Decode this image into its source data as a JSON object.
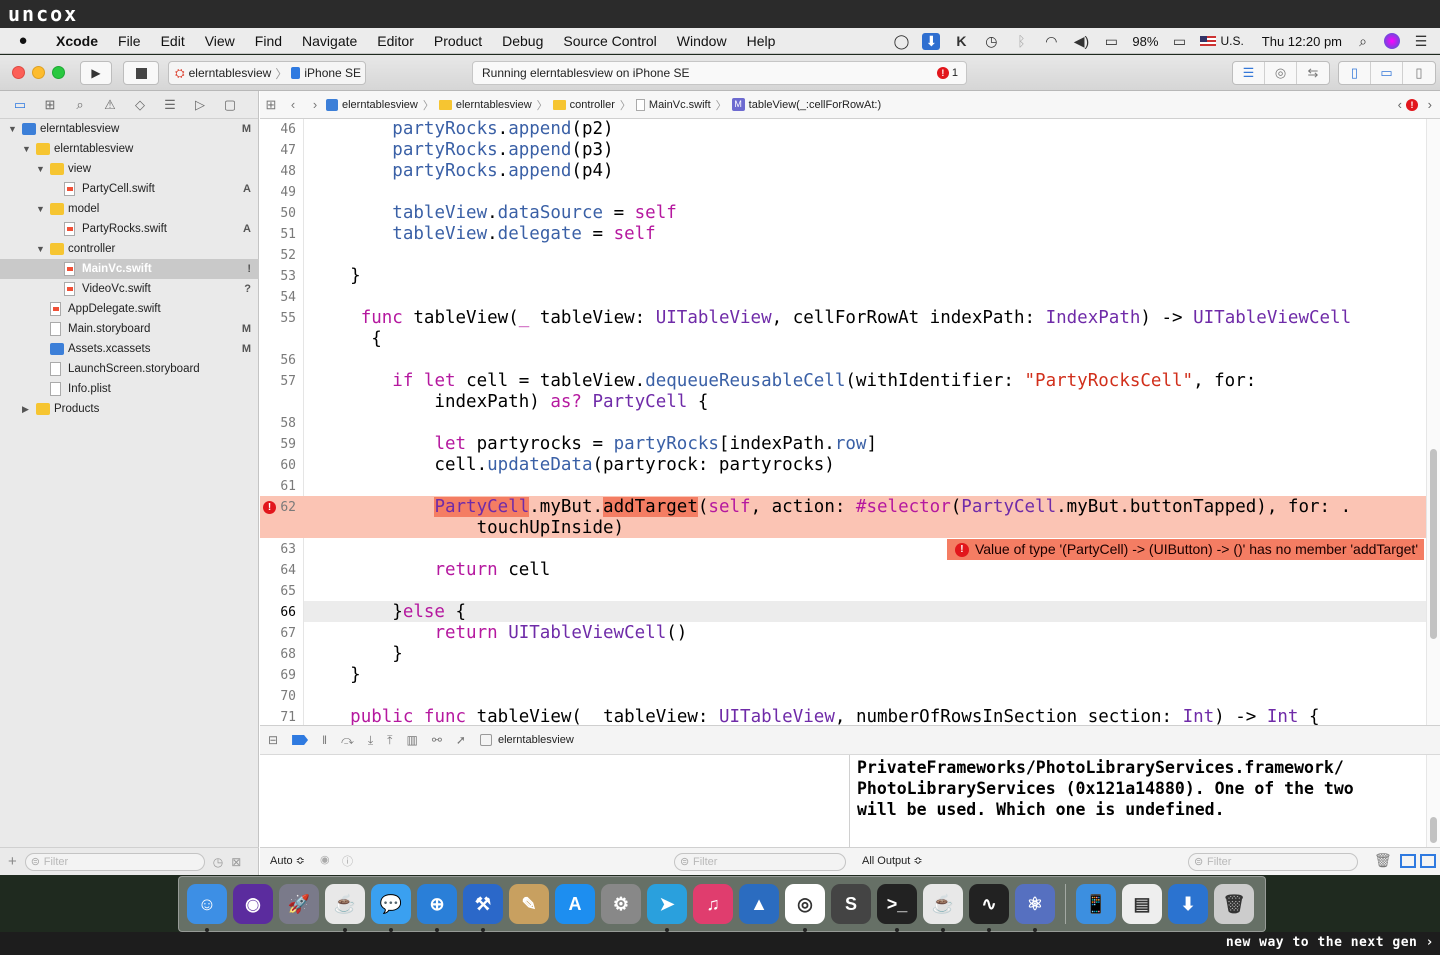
{
  "banner": {
    "logo": "uncox",
    "tagline": "new way to the next gen ›"
  },
  "menubar": {
    "apple_icon": "apple-icon",
    "app_name": "Xcode",
    "items": [
      "File",
      "Edit",
      "View",
      "Find",
      "Navigate",
      "Editor",
      "Product",
      "Debug",
      "Source Control",
      "Window",
      "Help"
    ],
    "status": {
      "battery": "98%",
      "input": "U.S.",
      "clock": "Thu 12:20 pm"
    }
  },
  "toolbar": {
    "scheme_target": "elerntablesview",
    "scheme_device": "iPhone SE",
    "activity_text": "Running elerntablesview on iPhone SE",
    "error_count": "1"
  },
  "navigator": {
    "items": [
      {
        "label": "elerntablesview",
        "status": "M",
        "kind": "project",
        "depth": 0,
        "open": true
      },
      {
        "label": "elerntablesview",
        "status": "",
        "kind": "folder",
        "depth": 1,
        "open": true
      },
      {
        "label": "view",
        "status": "",
        "kind": "folder",
        "depth": 2,
        "open": true
      },
      {
        "label": "PartyCell.swift",
        "status": "A",
        "kind": "swift",
        "depth": 3
      },
      {
        "label": "model",
        "status": "",
        "kind": "folder",
        "depth": 2,
        "open": true
      },
      {
        "label": "PartyRocks.swift",
        "status": "A",
        "kind": "swift",
        "depth": 3
      },
      {
        "label": "controller",
        "status": "",
        "kind": "folder",
        "depth": 2,
        "open": true
      },
      {
        "label": "MainVc.swift",
        "status": "!",
        "kind": "swift",
        "depth": 3,
        "selected": true
      },
      {
        "label": "VideoVc.swift",
        "status": "?",
        "kind": "swift",
        "depth": 3
      },
      {
        "label": "AppDelegate.swift",
        "status": "",
        "kind": "swift",
        "depth": 2
      },
      {
        "label": "Main.storyboard",
        "status": "M",
        "kind": "file",
        "depth": 2
      },
      {
        "label": "Assets.xcassets",
        "status": "M",
        "kind": "assets",
        "depth": 2
      },
      {
        "label": "LaunchScreen.storyboard",
        "status": "",
        "kind": "file",
        "depth": 2
      },
      {
        "label": "Info.plist",
        "status": "",
        "kind": "file",
        "depth": 2
      },
      {
        "label": "Products",
        "status": "",
        "kind": "folder",
        "depth": 1,
        "open": false
      }
    ],
    "filter_placeholder": "Filter"
  },
  "jumpbar": {
    "crumbs": [
      "elerntablesview",
      "elerntablesview",
      "controller",
      "MainVc.swift",
      "tableView(_:cellForRowAt:)"
    ]
  },
  "editor": {
    "error_message": "Value of type '(PartyCell) -> (UIButton) -> ()' has no member 'addTarget'",
    "current_line": "66",
    "error_line": "62"
  },
  "debug": {
    "process": "elerntablesview",
    "console_lines": [
      "PrivateFrameworks/PhotoLibraryServices.framework/",
      "PhotoLibraryServices (0x121a14880). One of the two",
      "will be used. Which one is undefined."
    ],
    "auto_label": "Auto ≎",
    "output_label": "All Output ≎",
    "filter_placeholder": "Filter"
  },
  "dock": {
    "apps": [
      "finder-icon",
      "siri-icon",
      "launchpad-icon",
      "java-icon",
      "messages-icon",
      "safari-icon",
      "xcode-icon",
      "preview-icon",
      "app-store-icon",
      "system-preferences-icon",
      "telegram-icon",
      "itunes-icon",
      "keynote-icon",
      "chrome-icon",
      "sublime-icon",
      "terminal-icon",
      "java2-icon",
      "activity-monitor-icon",
      "network-icon",
      "simulator-icon",
      "plist-file-icon",
      "downloads-icon",
      "trash-icon"
    ]
  }
}
